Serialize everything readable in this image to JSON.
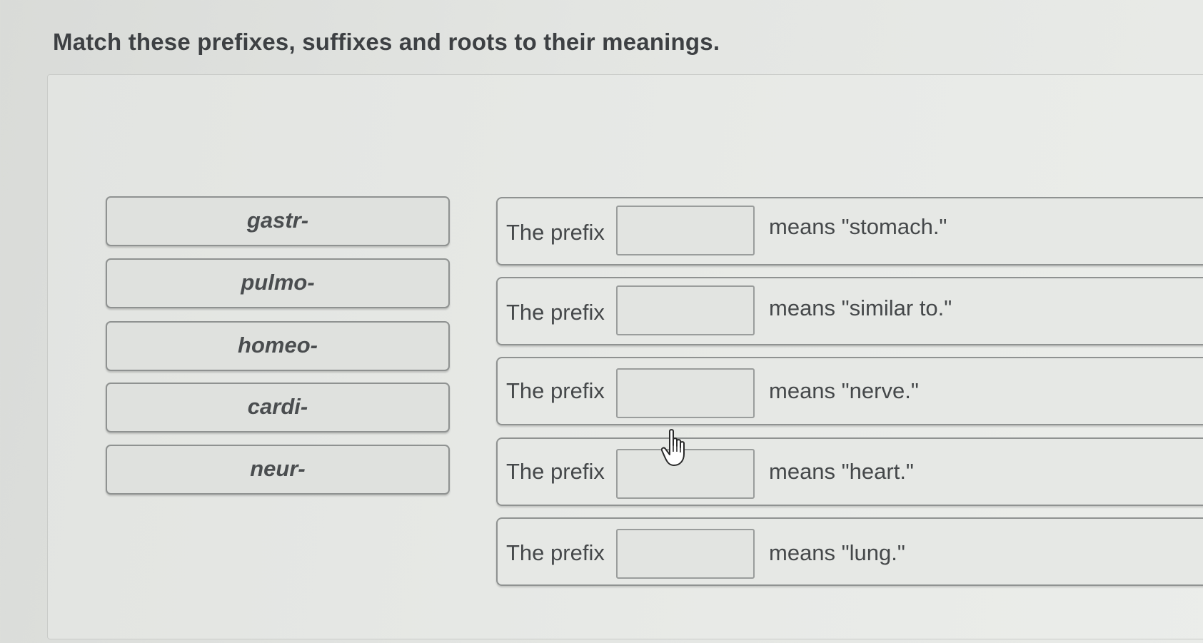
{
  "title": "Match these prefixes, suffixes and roots to their meanings.",
  "chips": [
    {
      "label": "gastr-"
    },
    {
      "label": "pulmo-"
    },
    {
      "label": "homeo-"
    },
    {
      "label": "cardi-"
    },
    {
      "label": "neur-"
    }
  ],
  "rows": [
    {
      "prefix_text": "The prefix",
      "meaning": "means \"stomach.\""
    },
    {
      "prefix_text": "The prefix",
      "meaning": "means \"similar to.\""
    },
    {
      "prefix_text": "The prefix",
      "meaning": "means \"nerve.\""
    },
    {
      "prefix_text": "The prefix",
      "meaning": "means \"heart.\""
    },
    {
      "prefix_text": "The prefix",
      "meaning": "means \"lung.\""
    }
  ],
  "cursor_icon": "hand-pointer-icon"
}
